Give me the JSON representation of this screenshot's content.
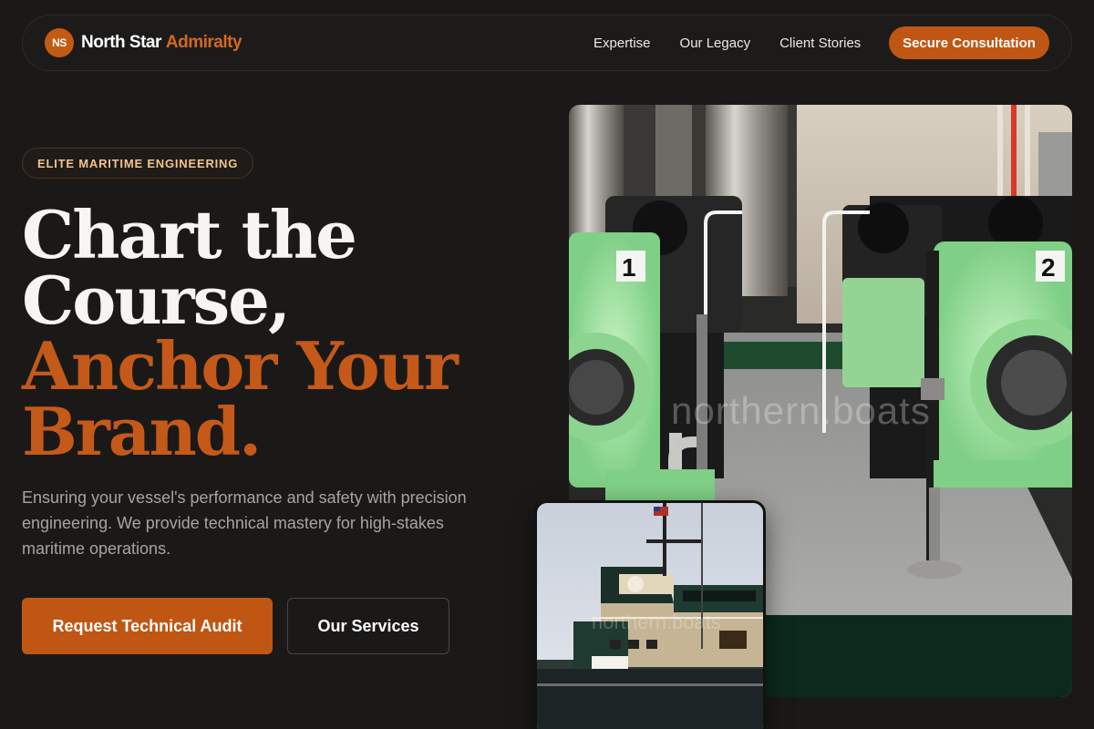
{
  "brand": {
    "badge": "NS",
    "name": "North Star",
    "accent": "Admiralty"
  },
  "nav": {
    "links": [
      "Expertise",
      "Our Legacy",
      "Client Stories"
    ],
    "cta": "Secure Consultation"
  },
  "hero": {
    "eyebrow": "ELITE MARITIME ENGINEERING",
    "headline": {
      "line1": "Chart the",
      "line2": "Course,",
      "line3": "Anchor Your",
      "line4": "Brand."
    },
    "subcopy": "Ensuring your vessel's performance and safety with precision engineering. We provide technical mastery for high-stakes maritime operations.",
    "primary_button": "Request Technical Audit",
    "secondary_button": "Our Services"
  },
  "images": {
    "engine_room": {
      "watermark": "northern.boats",
      "labels": [
        "1",
        "2"
      ]
    },
    "ship": {
      "watermark": "northern.boats"
    }
  },
  "colors": {
    "background": "#1b1918",
    "accent": "#c05613",
    "headline_accent": "#c4591a",
    "eyebrow_text": "#f1c48c",
    "muted_text": "#a9a39d",
    "machine_green": "#9fe3a0"
  }
}
